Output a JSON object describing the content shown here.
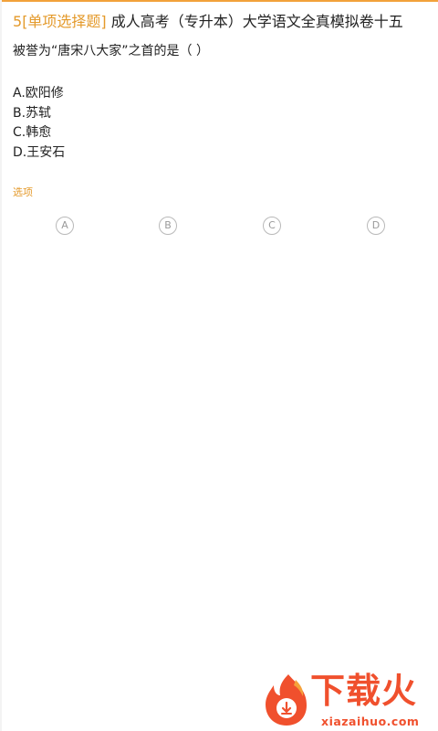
{
  "question": {
    "number": "5",
    "type_label": "[单项选择题]",
    "title": "成人高考（专升本）大学语文全真模拟卷十五",
    "stem": "被誉为“唐宋八大家”之首的是（   ）",
    "options": [
      "A.欧阳修",
      "B.苏轼",
      "C.韩愈",
      "D.王安石"
    ]
  },
  "answer_section": {
    "label": "选项",
    "choices": [
      "A",
      "B",
      "C",
      "D"
    ]
  },
  "watermark": {
    "name": "下载火",
    "url": "xiazaihuo.com"
  },
  "colors": {
    "accent": "#e49a2b",
    "top_rule": "#f2a23a",
    "brand": "#f0502d"
  }
}
